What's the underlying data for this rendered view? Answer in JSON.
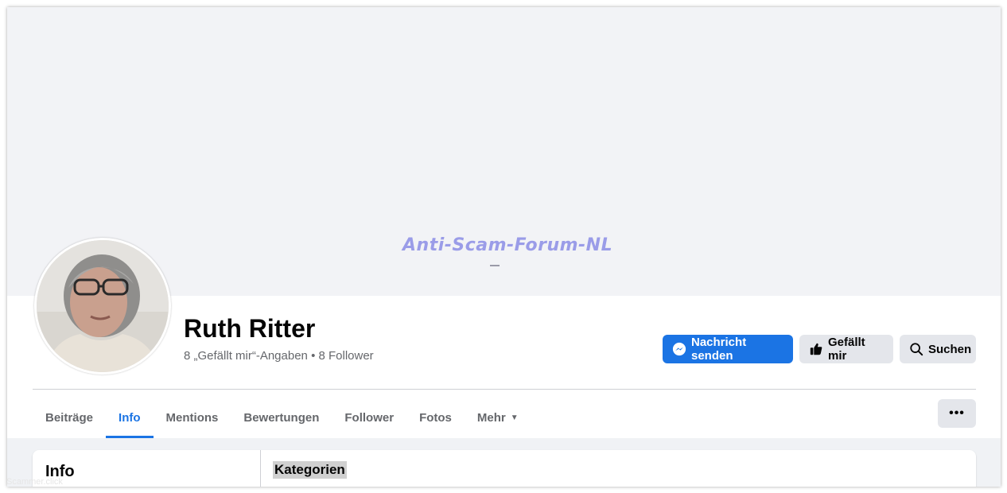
{
  "cover": {
    "watermark": "Anti-Scam-Forum-NL"
  },
  "profile": {
    "name": "Ruth Ritter",
    "stats": "8 „Gefällt mir“-Angaben • 8 Follower"
  },
  "actions": {
    "message": "Nachricht senden",
    "like": "Gefällt mir",
    "search": "Suchen",
    "more": "•••"
  },
  "tabs": [
    {
      "label": "Beiträge",
      "active": false
    },
    {
      "label": "Info",
      "active": true
    },
    {
      "label": "Mentions",
      "active": false
    },
    {
      "label": "Bewertungen",
      "active": false
    },
    {
      "label": "Follower",
      "active": false
    },
    {
      "label": "Fotos",
      "active": false
    },
    {
      "label": "Mehr",
      "active": false
    }
  ],
  "info_card": {
    "title": "Info",
    "section": "Kategorien"
  },
  "footer_watermark": "Scammer.click",
  "colors": {
    "accent": "#1b74e4",
    "button_gray": "#e4e6eb",
    "cover_bg": "#f2f3f6",
    "muted_text": "#65676b"
  },
  "icons": [
    "messenger-icon",
    "thumbs-up-icon",
    "search-icon",
    "caret-down-icon",
    "more-dots-icon"
  ]
}
